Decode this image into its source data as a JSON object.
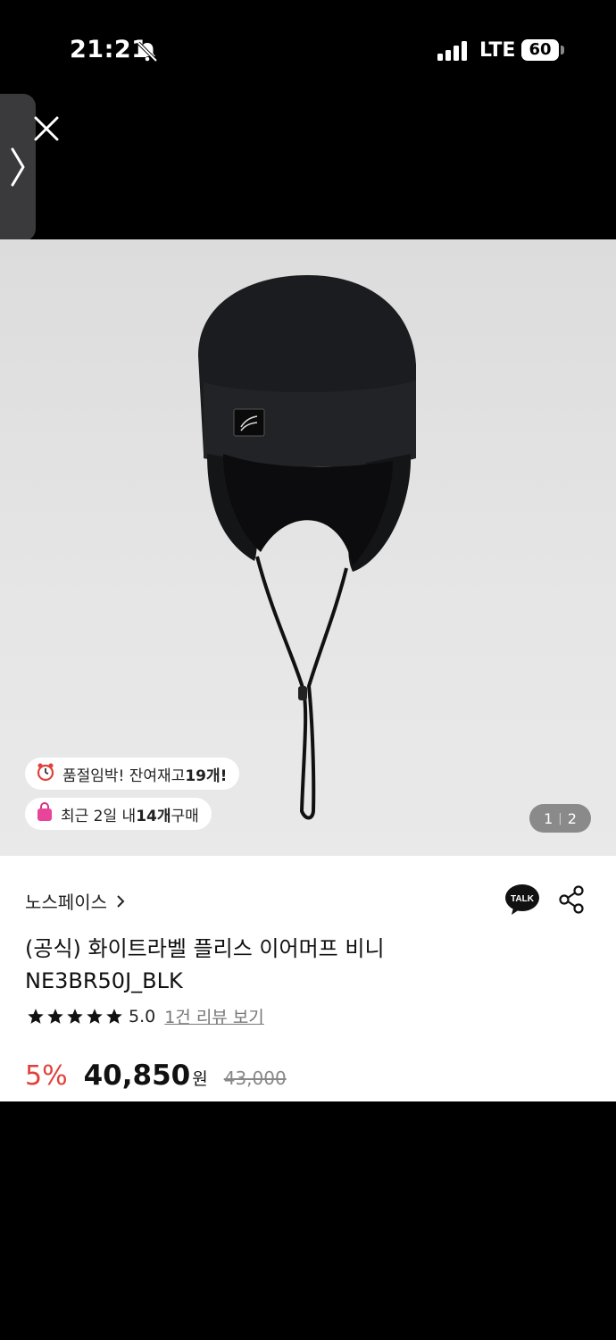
{
  "status_bar": {
    "time": "21:21",
    "network": "LTE",
    "battery": "60"
  },
  "product_image": {
    "stock_alert": {
      "text": "품절임박! 잔여재고 ",
      "count": "19개!"
    },
    "recent_purchase": {
      "prefix": "최근 2일 내 ",
      "count": "14개",
      "suffix": " 구매"
    },
    "page_indicator": {
      "current": "1",
      "total": "2"
    }
  },
  "product": {
    "brand": "노스페이스",
    "title_line1": "(공식) 화이트라벨 플리스 이어머프 비니",
    "title_line2": "NE3BR50J_BLK",
    "rating": "5.0",
    "review_link": "1건 리뷰 보기",
    "discount": "5%",
    "price": "40,850",
    "currency": "원",
    "original_price": "43,000"
  },
  "icons": {
    "talk": "TALK",
    "talk_color": "#111111",
    "discount_color": "#e2403a"
  }
}
